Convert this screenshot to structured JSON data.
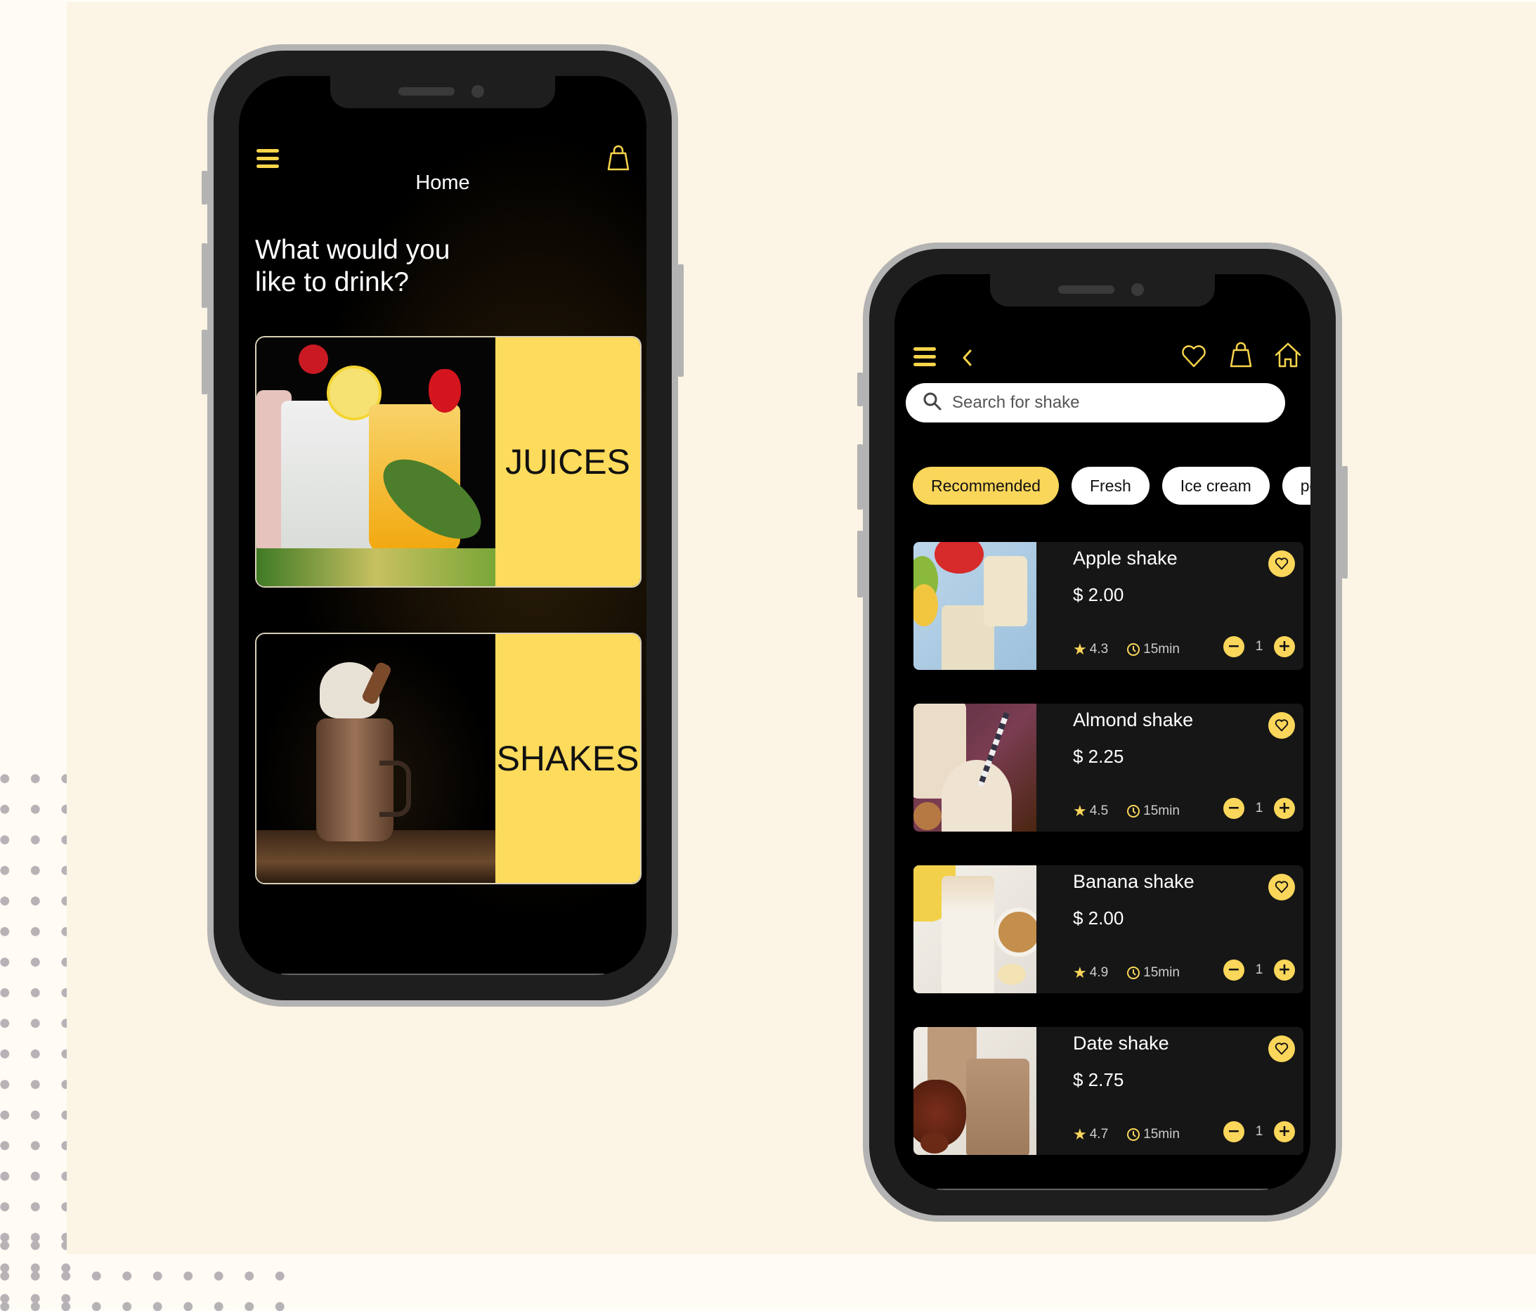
{
  "colors": {
    "accent": "#fad65a",
    "background": "#fcf4e4",
    "screen": "#000000",
    "card": "#161616"
  },
  "home_screen": {
    "title": "Home",
    "menu_icon": "hamburger-menu-icon",
    "cart_icon": "shopping-bag-icon",
    "headline_line1": "What would you",
    "headline_line2": "like to drink?",
    "categories": [
      {
        "label": "JUICES",
        "image": "juice-jars-photo"
      },
      {
        "label": "SHAKES",
        "image": "chocolate-milkshake-photo"
      }
    ]
  },
  "list_screen": {
    "icons": {
      "menu": "hamburger-menu-icon",
      "back": "chevron-left-icon",
      "favorites": "heart-icon",
      "cart": "shopping-bag-icon",
      "home": "home-icon"
    },
    "search": {
      "placeholder": "Search for shake",
      "value": ""
    },
    "chips": [
      {
        "label": "Recommended",
        "active": true
      },
      {
        "label": "Fresh",
        "active": false
      },
      {
        "label": "Ice cream",
        "active": false
      },
      {
        "label": "po",
        "active": false
      }
    ],
    "items": [
      {
        "name": "Apple shake",
        "price": "$ 2.00",
        "rating": "4.3",
        "time": "15min",
        "quantity": "1"
      },
      {
        "name": "Almond shake",
        "price": "$ 2.25",
        "rating": "4.5",
        "time": "15min",
        "quantity": "1"
      },
      {
        "name": "Banana shake",
        "price": "$ 2.00",
        "rating": "4.9",
        "time": "15min",
        "quantity": "1"
      },
      {
        "name": "Date shake",
        "price": "$ 2.75",
        "rating": "4.7",
        "time": "15min",
        "quantity": "1"
      }
    ],
    "decrement_symbol": "−",
    "increment_symbol": "+",
    "star_symbol": "★"
  }
}
